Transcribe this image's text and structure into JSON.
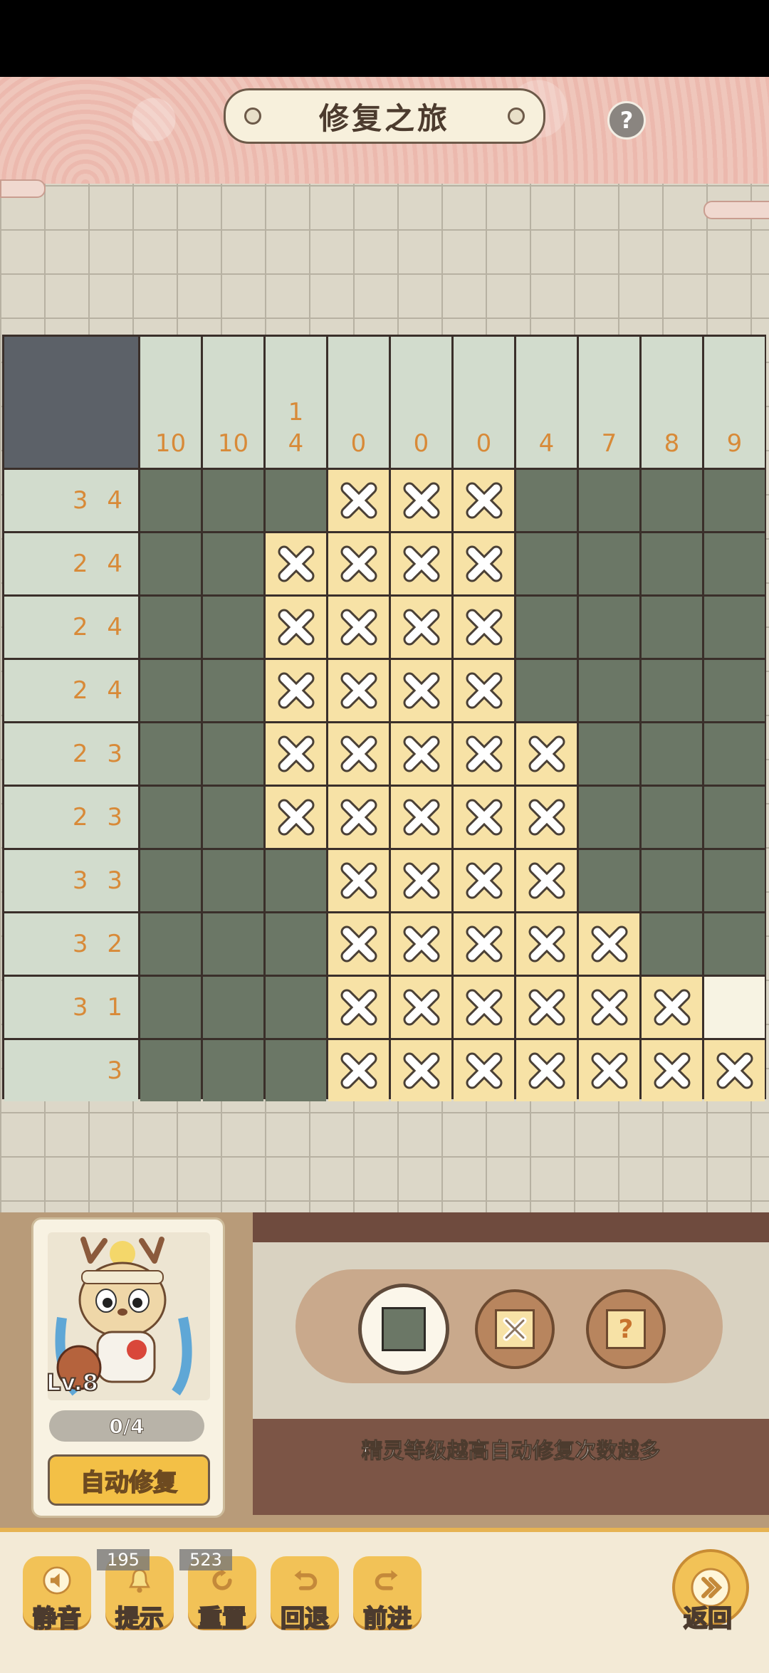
{
  "header": {
    "title": "修复之旅",
    "help": "?"
  },
  "puzzle": {
    "col_clues": [
      [
        "10"
      ],
      [
        "10"
      ],
      [
        "1",
        "4"
      ],
      [
        "0"
      ],
      [
        "0"
      ],
      [
        "0"
      ],
      [
        "4"
      ],
      [
        "7"
      ],
      [
        "8"
      ],
      [
        "9"
      ]
    ],
    "row_clues": [
      "3 4",
      "2 4",
      "2 4",
      "2 4",
      "2 3",
      "2 3",
      "3 3",
      "3 2",
      "3 1",
      "3"
    ],
    "grid": [
      "fffxxxffff",
      "ffxxxxffff",
      "ffxxxxffff",
      "ffxxxxffff",
      "ffxxxxxfff",
      "ffxxxxxfff",
      "fffxxxxfff",
      "fffxxxxxff",
      "fffxxxxxxe",
      "fffxxxxxxx"
    ]
  },
  "spirit": {
    "level": "Lv.8",
    "progress": "0/4",
    "auto_repair": "自动修复"
  },
  "tools": {
    "hint": "精灵等级越高自动修复次数越多"
  },
  "bottom_bar": {
    "mute": "静音",
    "hint": "提示",
    "hint_count": "195",
    "reset": "重置",
    "reset_count": "523",
    "undo": "回退",
    "redo": "前进",
    "back": "返回"
  }
}
